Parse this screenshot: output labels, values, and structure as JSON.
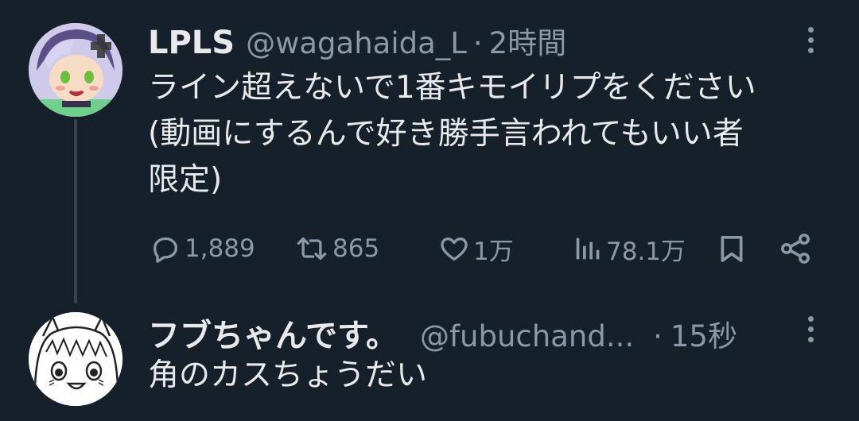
{
  "colors": {
    "background": "#15202b",
    "primary_text": "#e7e9ea",
    "secondary_text": "#8b98a5",
    "thread_line": "#38444d"
  },
  "tweets": [
    {
      "display_name": "LPLS",
      "handle": "@wagahaida_L",
      "separator": "·",
      "time": "2時間",
      "text_lines": [
        "ライン超えないで1番キモイリプをください",
        "(動画にするんで好き勝手言われてもいい者",
        "限定)"
      ],
      "actions": {
        "reply_icon": "reply-icon",
        "reply_count": "1,889",
        "retweet_icon": "retweet-icon",
        "retweet_count": "865",
        "like_icon": "heart-icon",
        "like_count": "1万",
        "views_icon": "views-icon",
        "views_count": "78.1万",
        "bookmark_icon": "bookmark-icon",
        "share_icon": "share-icon"
      },
      "more_icon": "more-options-icon"
    },
    {
      "display_name": "フブちゃんです。",
      "handle": "@fubuchand...",
      "separator": "·",
      "time": "15秒",
      "text_lines": [
        "角のカスちょうだい"
      ],
      "more_icon": "more-options-icon"
    }
  ]
}
